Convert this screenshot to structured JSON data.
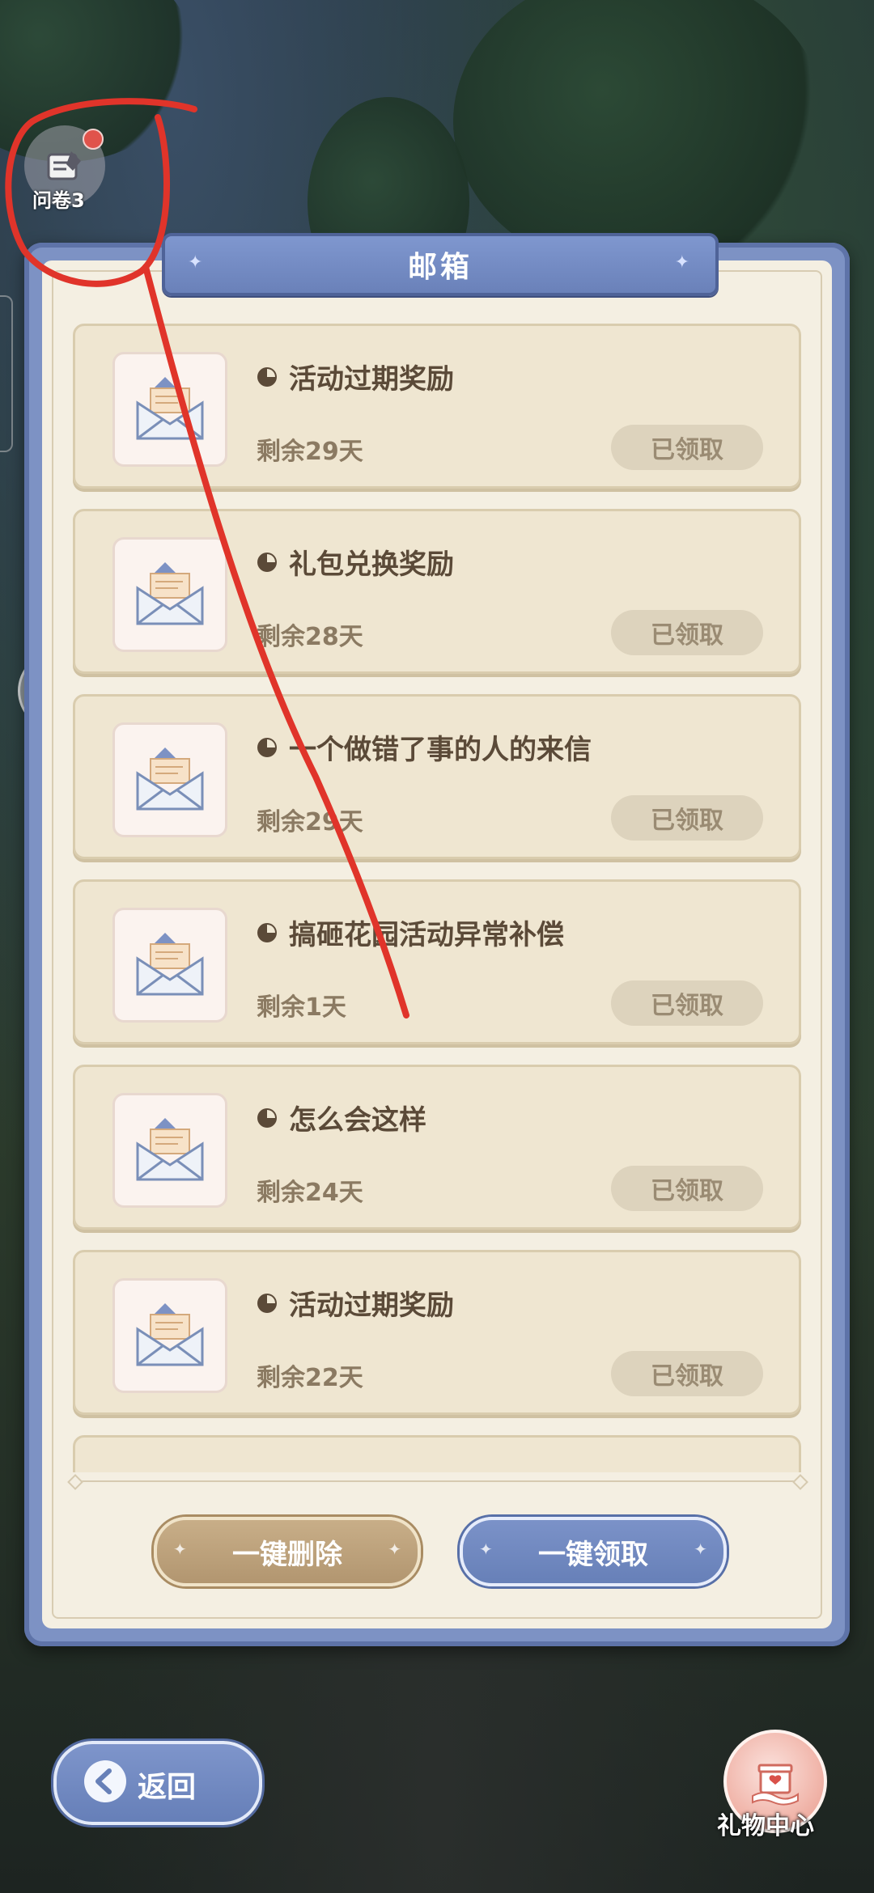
{
  "survey": {
    "label": "问卷3",
    "icon": "survey-scroll-icon"
  },
  "mailbox": {
    "title": "邮箱",
    "items": [
      {
        "title": "活动过期奖励",
        "days_left": "剩余29天",
        "status": "已领取"
      },
      {
        "title": "礼包兑换奖励",
        "days_left": "剩余28天",
        "status": "已领取"
      },
      {
        "title": "一个做错了事的人的来信",
        "days_left": "剩余29天",
        "status": "已领取"
      },
      {
        "title": "搞砸花园活动异常补偿",
        "days_left": "剩余1天",
        "status": "已领取"
      },
      {
        "title": "怎么会这样",
        "days_left": "剩余24天",
        "status": "已领取"
      },
      {
        "title": "活动过期奖励",
        "days_left": "剩余22天",
        "status": "已领取"
      }
    ],
    "delete_all_label": "一键删除",
    "claim_all_label": "一键领取"
  },
  "back_button": {
    "label": "返回"
  },
  "gift_center": {
    "label": "礼物中心"
  },
  "colors": {
    "panel_blue": "#7d92c4",
    "panel_bg": "#f4efe2",
    "item_bg": "#efe6d1",
    "delete_gold": "#b29670",
    "annotation_red": "#e0342a"
  }
}
